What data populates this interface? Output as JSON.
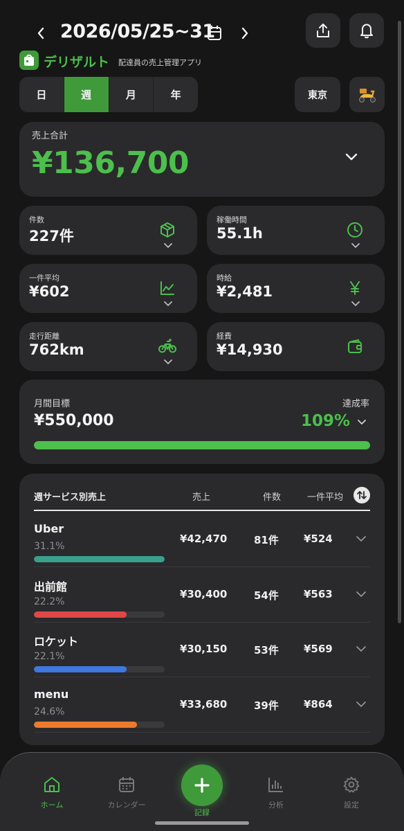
{
  "header": {
    "date_range": "2026/05/25~31",
    "app_name": "デリザルト",
    "app_subtitle": "配達員の売上管理アプリ"
  },
  "period_tabs": [
    {
      "label": "日",
      "active": false
    },
    {
      "label": "週",
      "active": true
    },
    {
      "label": "月",
      "active": false
    },
    {
      "label": "年",
      "active": false
    }
  ],
  "region_button": "東京",
  "total": {
    "label": "売上合計",
    "value": "¥136,700"
  },
  "stats": [
    {
      "label": "件数",
      "value": "227件",
      "icon": "package-icon"
    },
    {
      "label": "稼働時間",
      "value": "55.1h",
      "icon": "clock-icon"
    },
    {
      "label": "一件平均",
      "value": "¥602",
      "icon": "line-chart-icon"
    },
    {
      "label": "時給",
      "value": "¥2,481",
      "icon": "yen-icon"
    },
    {
      "label": "走行距離",
      "value": "762km",
      "icon": "bicycle-icon"
    },
    {
      "label": "経費",
      "value": "¥14,930",
      "icon": "wallet-icon"
    }
  ],
  "goal": {
    "label": "月間目標",
    "value": "¥550,000",
    "rate_label": "達成率",
    "rate_value": "109%",
    "progress": 1.0
  },
  "services": {
    "title": "週サービス別売上",
    "col_sales": "売上",
    "col_count": "件数",
    "col_avg": "一件平均",
    "rows": [
      {
        "name": "Uber",
        "pct": "31.1%",
        "share": 1.0,
        "sales": "¥42,470",
        "count": "81件",
        "avg": "¥524",
        "color": "#3aa08e"
      },
      {
        "name": "出前館",
        "pct": "22.2%",
        "share": 0.71,
        "sales": "¥30,400",
        "count": "54件",
        "avg": "¥563",
        "color": "#e04848"
      },
      {
        "name": "ロケット",
        "pct": "22.1%",
        "share": 0.71,
        "sales": "¥30,150",
        "count": "53件",
        "avg": "¥569",
        "color": "#3f78e0"
      },
      {
        "name": "menu",
        "pct": "24.6%",
        "share": 0.79,
        "sales": "¥33,680",
        "count": "39件",
        "avg": "¥864",
        "color": "#ee7a2e"
      }
    ]
  },
  "nav": {
    "home": "ホーム",
    "calendar": "カレンダー",
    "record": "記録",
    "analysis": "分析",
    "settings": "設定"
  },
  "colors": {
    "accent_green": "#4cbf4c",
    "card_bg": "#2a2a2c",
    "page_bg": "#161616"
  }
}
